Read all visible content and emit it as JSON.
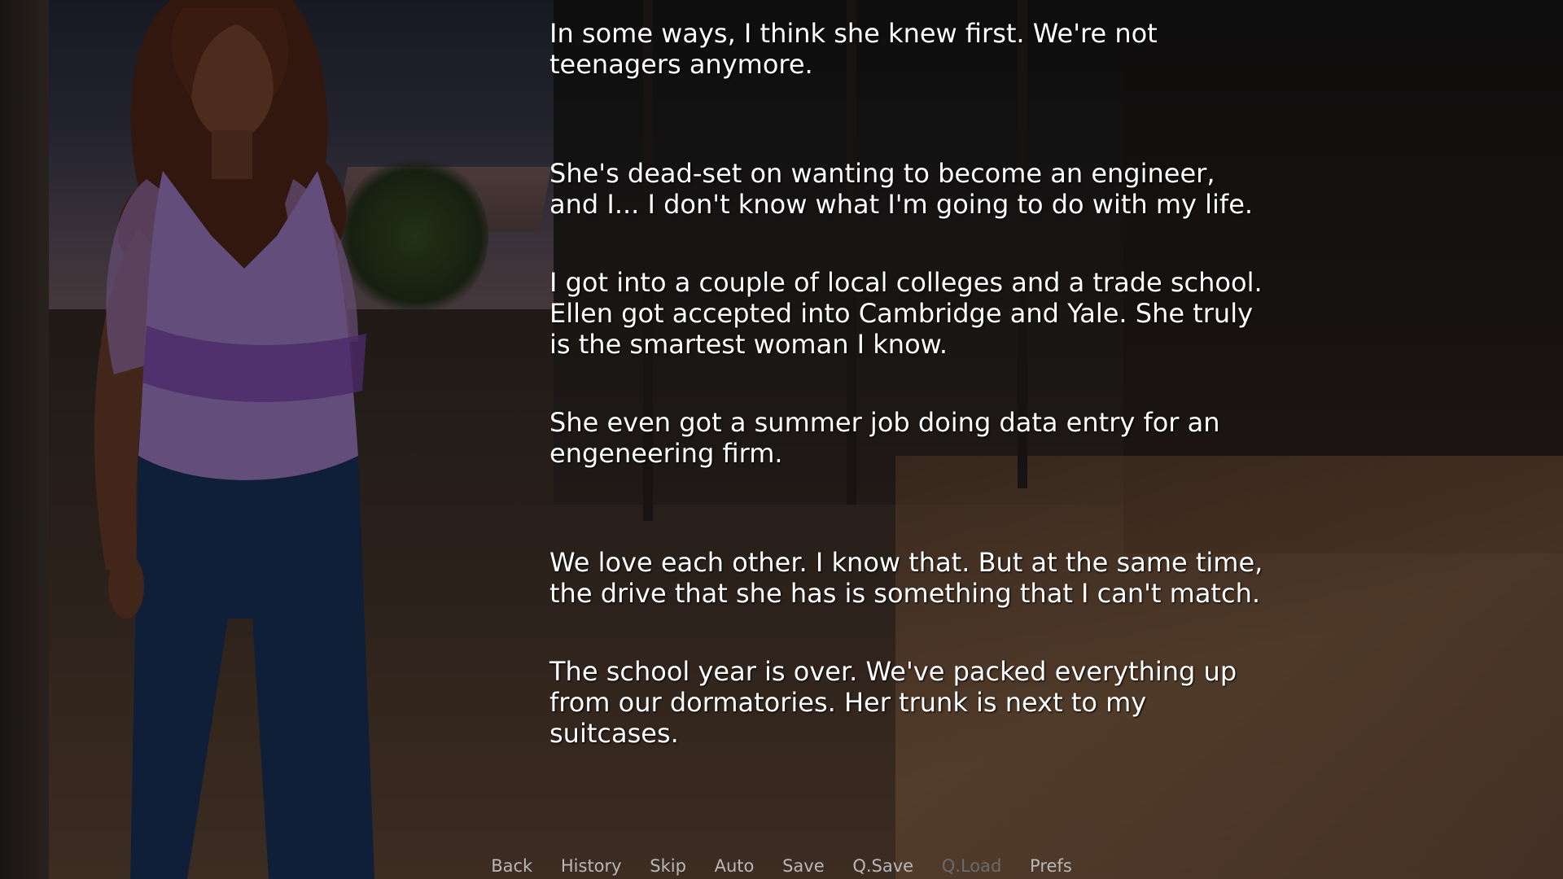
{
  "nvl": {
    "paragraphs": [
      "In some ways, I think she knew first. We're not teenagers anymore.",
      "She's dead-set on wanting to become an engineer, and I... I don't know what I'm going to do with my life.",
      "I got into a couple of local colleges and a trade school. Ellen got accepted into Cambridge and Yale. She truly is the smartest woman I know.",
      "She even got a summer job doing data entry for an engeneering firm.",
      "We love each other. I know that. But at the same time, the drive that she has is something that I can't match.",
      "The school year is over. We've packed everything up from our dormatories. Her trunk is next to my suitcases."
    ]
  },
  "quick_menu": {
    "back": "Back",
    "history": "History",
    "skip": "Skip",
    "auto": "Auto",
    "save": "Save",
    "qsave": "Q.Save",
    "qload": "Q.Load",
    "prefs": "Prefs"
  },
  "colors": {
    "text": "#ffffff",
    "menu_active": "#b8b8b8",
    "menu_disabled": "#6a6a6a"
  }
}
